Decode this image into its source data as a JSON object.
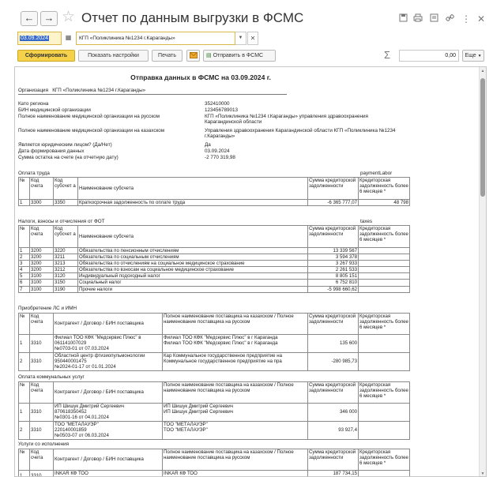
{
  "window": {
    "title": "Отчет по данным выгрузки в ФСМС",
    "back_icon": "←",
    "forward_icon": "→",
    "star_icon": "☆"
  },
  "params": {
    "date": "03.09.2024",
    "organization": "КГП «Поликлиника №1234 г.Караганды»"
  },
  "toolbar": {
    "generate": "Сформировать",
    "show_settings": "Показать настройки",
    "print": "Печать",
    "send": "Отправить в ФСМС",
    "sum_value": "0,00",
    "more": "Еще"
  },
  "report": {
    "title": "Отправка данных в ФСМС на 03.09.2024 г.",
    "org_label": "Организация",
    "org_value": "КГП «Поликлиника №1234 г.Караганды»",
    "info": [
      {
        "key": "Като региона",
        "value": "352410000"
      },
      {
        "key": "БИН медицинской организации",
        "value": "123456789013"
      },
      {
        "key": "Полное наименование медицинской организации на русском",
        "value": "КГП «Поликлиника №1234 г.Караганды» управления здравоохранения Карагандинской области"
      },
      {
        "key": "Полное наименование медицинской организации на казахском",
        "value": "Управления здравоохранения Карагандинской области КГП «Поликлиника №1234 г.Караганды»"
      },
      {
        "key": "Является юридическим лицом? (Да/Нет)",
        "value": "Да"
      },
      {
        "key": "Дата формирования данных",
        "value": "03.09.2024"
      },
      {
        "key": "Сумма остатка на счете (на отчетную дату)",
        "value": "-2 770 319,98"
      }
    ],
    "s1": {
      "title": "Оплата труда",
      "tag": "paymentLabor",
      "headers": [
        "№",
        "Код счета",
        "Код субсчет а",
        "Наименование субсчета",
        "Сумма кредиторской задолженности",
        "Кредиторская задолженность более 6 месяцев *"
      ],
      "rows": [
        [
          "1",
          "3300",
          "3350",
          "Краткосрочная задолженность по оплате труда",
          "-6 365 777,07",
          "48 798"
        ]
      ]
    },
    "s2": {
      "title": "Налоги, взносы и отчисления от ФОТ",
      "tag": "taxes",
      "headers": [
        "№",
        "Код счета",
        "Код субсчет а",
        "Наименование субсчета",
        "Сумма кредиторской задолженности",
        "Кредиторская задолженность более 6 месяцев *"
      ],
      "rows": [
        [
          "1",
          "3200",
          "3220",
          "Обязательства по пенсионным отчислениям",
          "13 339 567",
          ""
        ],
        [
          "2",
          "3200",
          "3211",
          "Обязательства по социальным отчислениям",
          "3 594 378",
          ""
        ],
        [
          "3",
          "3200",
          "3213",
          "Обязательства по отчислениям на социальное медицинское страхование",
          "3 267 933",
          ""
        ],
        [
          "4",
          "3200",
          "3212",
          "Обязательства по взносам на социальное медицинское страхование",
          "2 261 533",
          ""
        ],
        [
          "5",
          "3100",
          "3120",
          "Индивидуальный подоходный налог",
          "8 805 151",
          ""
        ],
        [
          "6",
          "3100",
          "3150",
          "Социальный налог",
          "6 752 810",
          ""
        ],
        [
          "7",
          "3100",
          "3190",
          "Прочие налоги",
          "-5 998 660,62",
          ""
        ]
      ]
    },
    "s3": {
      "title": "Приобретение ЛС и ИМН",
      "headers": [
        "№",
        "Код счета",
        "Контрагент / Договор / БИН поставщика",
        "Полное наименование поставщика на казахском / Полное наименование поставщика на русском",
        "Сумма кредиторской задолженности",
        "Кредиторская задолженность более 6 месяцев *"
      ],
      "rows": [
        {
          "no": "1",
          "acc": "3310",
          "cp1": "Филиал ТОО КФК \"Медсервис Плюс\" в",
          "cp2": "061141007029",
          "cp3": "№0703-01 от 07.03.2024",
          "nm1": "Филиал ТОО КФК \"Медсервис Плюс\" в г Караганда",
          "nm2": "Филиал ТОО КФК \"Медсервис Плюс\" в г Караганда",
          "sum": "135 600"
        },
        {
          "no": "2",
          "acc": "3310",
          "cp1": "Областной центр фтизиопульмонологии",
          "cp2": "950440001475",
          "cp3": "№2024-01-17 от 01.01.2024",
          "nm1": "Кар Коммунальное государственное предприятие на",
          "nm2": "Коммунальное государственное предприятие на пра",
          "sum": "-280 985,73"
        }
      ]
    },
    "s4": {
      "title": "Оплата коммунальных услуг",
      "headers": [
        "№",
        "Код счета",
        "Контрагент / Договор / БИН поставщика",
        "Полное наименование поставщика на казахском / Полное наименование поставщика на русском",
        "Сумма кредиторской задолженности",
        "Кредиторская задолженность более 6 месяцев *"
      ],
      "rows": [
        {
          "no": "1",
          "acc": "3310",
          "cp1": "ИП Шишук Дмитрий Сергеевич",
          "cp2": "870618350452",
          "cp3": "№0301-16 от 04.01.2024",
          "nm1": "ИП Шишук Дмитрий Сергеевич",
          "nm2": "ИП Шишук Дмитрий Сергеевич",
          "sum": "346 000"
        },
        {
          "no": "2",
          "acc": "3310",
          "cp1": "ТОО \"МЕТАЛАУЭР\"",
          "cp2": "220140001859",
          "cp3": "№0503-07 от 06.03.2024",
          "nm1": "ТОО \"МЕТАЛАУЭР\"",
          "nm2": "ТОО \"МЕТАЛАУЭР\"",
          "sum": "93 927,4"
        }
      ]
    },
    "s5": {
      "title": "Услуги со исполнения",
      "headers": [
        "№",
        "Код счета",
        "Контрагент / Договор / БИН поставщика",
        "Полное наименование поставщика на казахском / Полное наименование поставщика на русском",
        "Сумма кредиторской задолженности",
        "Кредиторская задолженность более 6 месяцев *"
      ],
      "rows": [
        {
          "no": "1",
          "acc": "3310",
          "cp1": "INKAR КФ ТОО",
          "nm1": "INKAR КФ ТОО",
          "sum": "187 734,15"
        }
      ]
    }
  }
}
